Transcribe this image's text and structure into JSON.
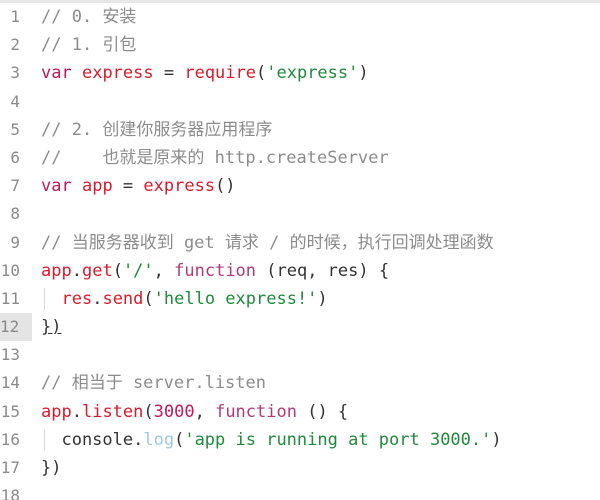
{
  "lines": [
    {
      "num": "1",
      "tokens": [
        {
          "t": "// 0. 安装",
          "c": "c"
        }
      ]
    },
    {
      "num": "2",
      "tokens": [
        {
          "t": "// 1. 引包",
          "c": "c"
        }
      ]
    },
    {
      "num": "3",
      "tokens": [
        {
          "t": "var",
          "c": "k"
        },
        {
          "t": " ",
          "c": "p"
        },
        {
          "t": "express",
          "c": "v"
        },
        {
          "t": " = ",
          "c": "p"
        },
        {
          "t": "require",
          "c": "f"
        },
        {
          "t": "(",
          "c": "p"
        },
        {
          "t": "'express'",
          "c": "s"
        },
        {
          "t": ")",
          "c": "p"
        }
      ]
    },
    {
      "num": "4",
      "tokens": []
    },
    {
      "num": "5",
      "tokens": [
        {
          "t": "// 2. 创建你服务器应用程序",
          "c": "c"
        }
      ]
    },
    {
      "num": "6",
      "tokens": [
        {
          "t": "//    也就是原来的 http.createServer",
          "c": "c"
        }
      ]
    },
    {
      "num": "7",
      "tokens": [
        {
          "t": "var",
          "c": "k"
        },
        {
          "t": " ",
          "c": "p"
        },
        {
          "t": "app",
          "c": "v"
        },
        {
          "t": " = ",
          "c": "p"
        },
        {
          "t": "express",
          "c": "f"
        },
        {
          "t": "()",
          "c": "p"
        }
      ]
    },
    {
      "num": "8",
      "tokens": []
    },
    {
      "num": "9",
      "tokens": [
        {
          "t": "// 当服务器收到 get 请求 / 的时候，执行回调处理函数",
          "c": "c"
        }
      ]
    },
    {
      "num": "10",
      "tokens": [
        {
          "t": "app",
          "c": "v"
        },
        {
          "t": ".",
          "c": "p"
        },
        {
          "t": "get",
          "c": "f"
        },
        {
          "t": "(",
          "c": "p"
        },
        {
          "t": "'/'",
          "c": "s"
        },
        {
          "t": ", ",
          "c": "p"
        },
        {
          "t": "function",
          "c": "kw"
        },
        {
          "t": " (req, res) {",
          "c": "p"
        }
      ]
    },
    {
      "num": "11",
      "guide": true,
      "tokens": [
        {
          "t": "  ",
          "c": "p"
        },
        {
          "t": "res",
          "c": "v"
        },
        {
          "t": ".",
          "c": "p"
        },
        {
          "t": "send",
          "c": "f"
        },
        {
          "t": "(",
          "c": "p"
        },
        {
          "t": "'hello express!'",
          "c": "s"
        },
        {
          "t": ")",
          "c": "p"
        }
      ]
    },
    {
      "num": "12",
      "active": true,
      "tokens": [
        {
          "t": "})",
          "c": "p"
        }
      ]
    },
    {
      "num": "13",
      "tokens": []
    },
    {
      "num": "14",
      "tokens": [
        {
          "t": "// 相当于 server.listen",
          "c": "c"
        }
      ]
    },
    {
      "num": "15",
      "tokens": [
        {
          "t": "app",
          "c": "v"
        },
        {
          "t": ".",
          "c": "p"
        },
        {
          "t": "listen",
          "c": "f"
        },
        {
          "t": "(",
          "c": "p"
        },
        {
          "t": "3000",
          "c": "n"
        },
        {
          "t": ", ",
          "c": "p"
        },
        {
          "t": "function",
          "c": "kw"
        },
        {
          "t": " () {",
          "c": "p"
        }
      ]
    },
    {
      "num": "16",
      "guide": true,
      "tokens": [
        {
          "t": "  console.",
          "c": "p"
        },
        {
          "t": "log",
          "c": "log"
        },
        {
          "t": "(",
          "c": "p"
        },
        {
          "t": "'app is running at port 3000.'",
          "c": "s"
        },
        {
          "t": ")",
          "c": "p"
        }
      ]
    },
    {
      "num": "17",
      "tokens": [
        {
          "t": "})",
          "c": "p"
        }
      ]
    },
    {
      "num": "18",
      "tokens": []
    }
  ],
  "colors": {
    "comment": "#8c8c8c",
    "keyword": "#c2185b",
    "string": "#1f8a3a",
    "identifier": "#d81b2c",
    "background": "#ffffff",
    "line_number": "#8a8a8a"
  }
}
